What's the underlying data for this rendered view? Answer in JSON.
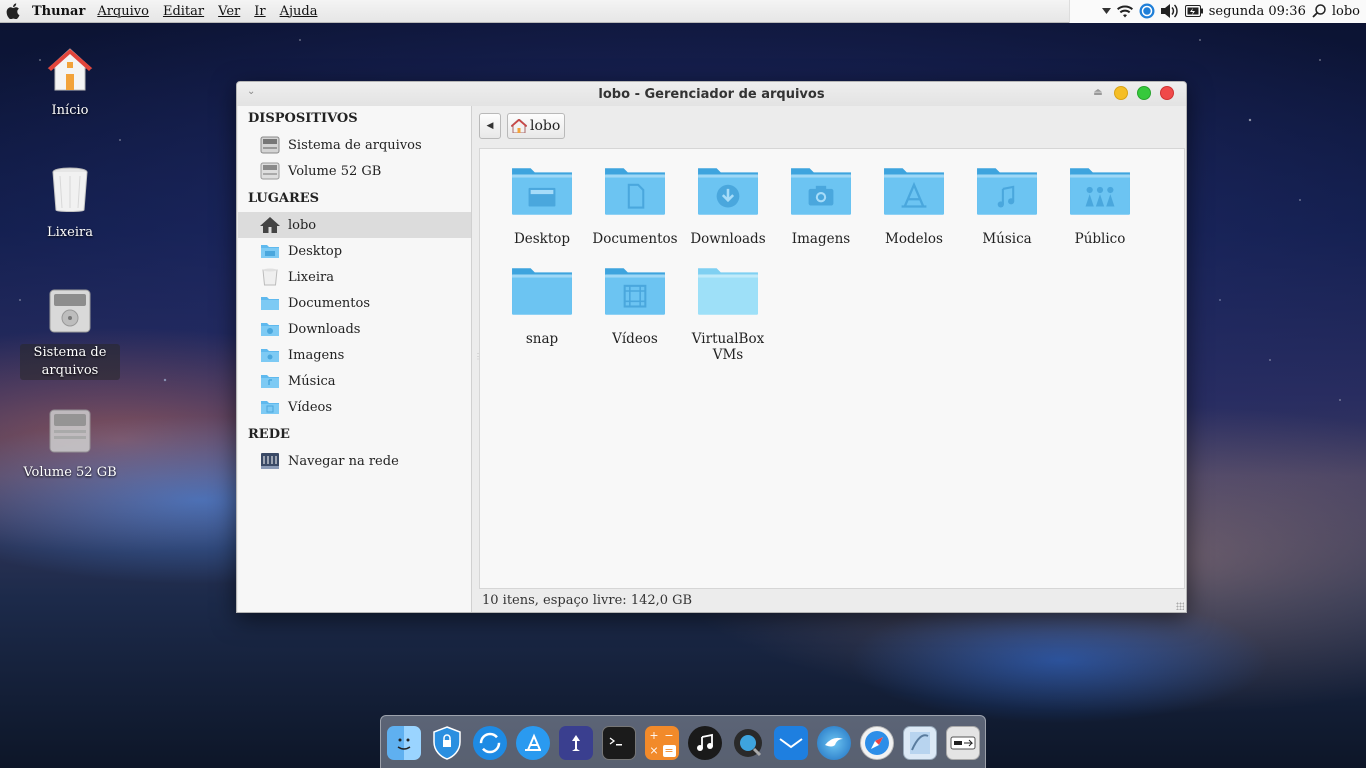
{
  "menubar": {
    "app_name": "Thunar",
    "menus": [
      "Arquivo",
      "Editar",
      "Ver",
      "Ir",
      "Ajuda"
    ],
    "clock": "segunda 09:36",
    "user": "lobo",
    "tray_icons": [
      "chevron-down-icon",
      "wifi-icon",
      "network-globe-icon",
      "volume-icon",
      "battery-icon",
      "search-icon"
    ]
  },
  "desktop": {
    "icons": [
      {
        "label": "Início",
        "icon": "home-icon"
      },
      {
        "label": "Lixeira",
        "icon": "trash-icon"
      },
      {
        "label": "Sistema de arquivos",
        "icon": "harddrive-icon"
      },
      {
        "label": "Volume 52 GB",
        "icon": "harddrive-icon"
      }
    ]
  },
  "window": {
    "title": "lobo - Gerenciador de arquivos",
    "sidebar": {
      "devices_title": "DISPOSITIVOS",
      "devices": [
        {
          "label": "Sistema de arquivos",
          "icon": "harddrive-icon"
        },
        {
          "label": "Volume 52 GB",
          "icon": "harddrive-icon"
        }
      ],
      "places_title": "LUGARES",
      "places": [
        {
          "label": "lobo",
          "icon": "home-icon",
          "active": true
        },
        {
          "label": "Desktop",
          "icon": "folder-icon"
        },
        {
          "label": "Lixeira",
          "icon": "trash-icon"
        },
        {
          "label": "Documentos",
          "icon": "folder-icon"
        },
        {
          "label": "Downloads",
          "icon": "folder-icon"
        },
        {
          "label": "Imagens",
          "icon": "folder-icon"
        },
        {
          "label": "Música",
          "icon": "folder-icon"
        },
        {
          "label": "Vídeos",
          "icon": "folder-icon"
        }
      ],
      "network_title": "REDE",
      "network": [
        {
          "label": "Navegar na rede",
          "icon": "network-icon"
        }
      ]
    },
    "pathbar": {
      "crumb": "lobo"
    },
    "files": [
      {
        "label": "Desktop",
        "emblem": "desktop"
      },
      {
        "label": "Documentos",
        "emblem": "document"
      },
      {
        "label": "Downloads",
        "emblem": "download"
      },
      {
        "label": "Imagens",
        "emblem": "camera"
      },
      {
        "label": "Modelos",
        "emblem": "template"
      },
      {
        "label": "Música",
        "emblem": "music"
      },
      {
        "label": "Público",
        "emblem": "people"
      },
      {
        "label": "snap",
        "emblem": "none"
      },
      {
        "label": "Vídeos",
        "emblem": "film"
      },
      {
        "label": "VirtualBox VMs",
        "emblem": "none-light"
      }
    ],
    "status": "10 itens, espaço livre: 142,0 GB"
  },
  "dock": {
    "apps": [
      "finder-icon",
      "security-shield-icon",
      "sync-icon",
      "app-store-icon",
      "settings-app-icon",
      "terminal-icon",
      "calculator-icon",
      "music-icon",
      "screen-recorder-icon",
      "mail-icon",
      "browser-eagle-icon",
      "safari-icon",
      "preview-icon",
      "input-device-icon"
    ]
  },
  "colors": {
    "folder": "#6cc4f2",
    "folder_dark": "#3ea4de",
    "window_bg": "#ececec",
    "sidebar_active": "#dcdcdc",
    "close": "#f04a4a",
    "minimize": "#f5be26",
    "maximize": "#36c93c"
  }
}
